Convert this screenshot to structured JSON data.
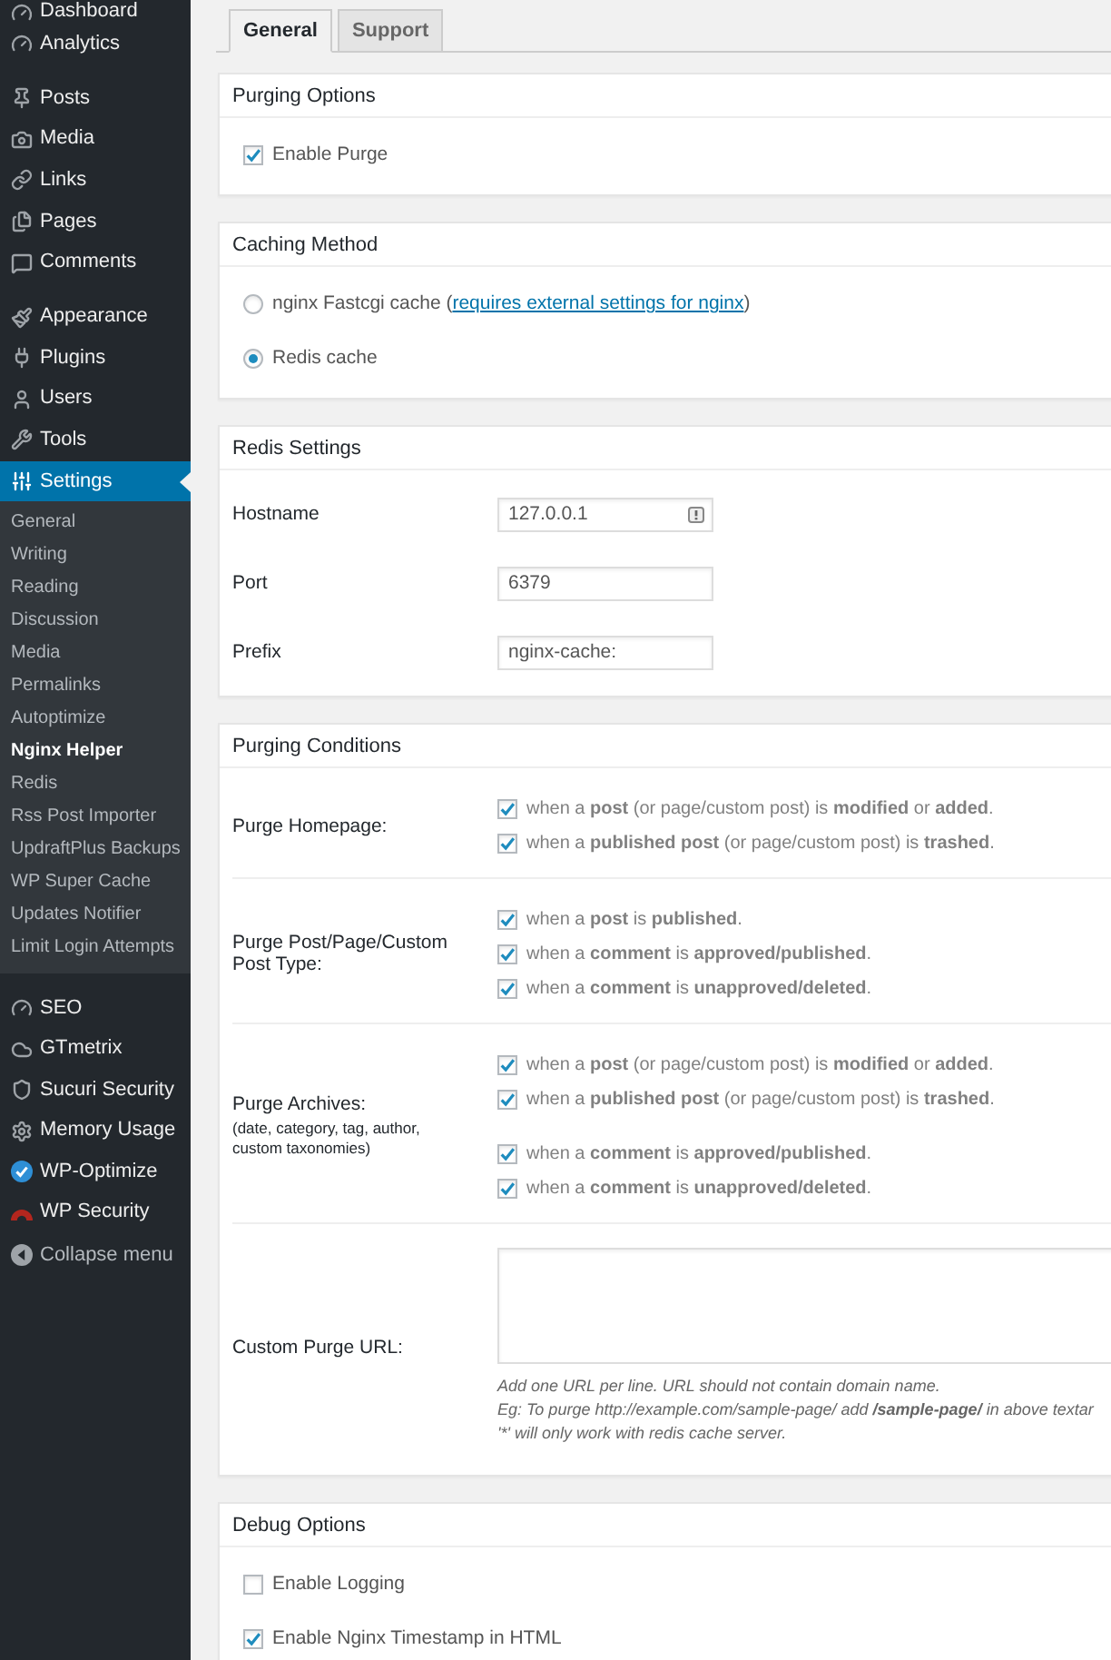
{
  "sidebar": {
    "groups": [
      {
        "items": [
          {
            "label": "Dashboard",
            "selected": false
          },
          {
            "label": "Analytics",
            "selected": false
          }
        ]
      },
      {
        "items": [
          {
            "label": "Posts",
            "selected": false
          },
          {
            "label": "Media",
            "selected": false
          },
          {
            "label": "Links",
            "selected": false
          },
          {
            "label": "Pages",
            "selected": false
          },
          {
            "label": "Comments",
            "selected": false
          }
        ]
      },
      {
        "items": [
          {
            "label": "Appearance",
            "selected": false
          },
          {
            "label": "Plugins",
            "selected": false
          },
          {
            "label": "Users",
            "selected": false
          },
          {
            "label": "Tools",
            "selected": false
          },
          {
            "label": "Settings",
            "selected": true,
            "children": [
              {
                "label": "General",
                "selected": false
              },
              {
                "label": "Writing",
                "selected": false
              },
              {
                "label": "Reading",
                "selected": false
              },
              {
                "label": "Discussion",
                "selected": false
              },
              {
                "label": "Media",
                "selected": false
              },
              {
                "label": "Permalinks",
                "selected": false
              },
              {
                "label": "Autoptimize",
                "selected": false
              },
              {
                "label": "Nginx Helper",
                "selected": true
              },
              {
                "label": "Redis",
                "selected": false
              },
              {
                "label": "Rss Post Importer",
                "selected": false
              },
              {
                "label": "UpdraftPlus Backups",
                "selected": false
              },
              {
                "label": "WP Super Cache",
                "selected": false
              },
              {
                "label": "Updates Notifier",
                "selected": false
              },
              {
                "label": "Limit Login Attempts",
                "selected": false
              }
            ]
          }
        ]
      },
      {
        "items": [
          {
            "label": "SEO",
            "selected": false
          },
          {
            "label": "GTmetrix",
            "selected": false
          },
          {
            "label": "Sucuri Security",
            "selected": false
          },
          {
            "label": "Memory Usage",
            "selected": false
          },
          {
            "label": "WP-Optimize",
            "selected": false
          },
          {
            "label": "WP Security",
            "selected": false
          }
        ]
      }
    ],
    "collapse": "Collapse menu"
  },
  "tabs": [
    {
      "label": "General",
      "selected": true
    },
    {
      "label": "Support",
      "selected": false
    }
  ],
  "sections": [
    {
      "title": "Purging Options",
      "kind": "checkboxes",
      "options": [
        {
          "label": "Enable Purge",
          "checked": true
        }
      ]
    },
    {
      "title": "Caching Method",
      "kind": "radios",
      "options": [
        {
          "label": "nginx Fastcgi cache (",
          "link": "requires external settings for nginx",
          "suffix": ")",
          "selected": false
        },
        {
          "label": "Redis cache",
          "selected": true
        }
      ]
    },
    {
      "title": "Redis Settings",
      "kind": "fields",
      "fields": [
        {
          "label": "Hostname",
          "value": "127.0.0.1",
          "autofill_badge": true
        },
        {
          "label": "Port",
          "value": "6379",
          "autofill_badge": false
        },
        {
          "label": "Prefix",
          "value": "nginx-cache:",
          "autofill_badge": false
        }
      ]
    },
    {
      "title": "Purging Conditions",
      "kind": "conditions",
      "rows": [
        {
          "kind": "checks",
          "label": "Purge Homepage:",
          "groups": [
            {
              "options": [
                {
                  "text": "when a **post** (or page/custom post) is **modified** or **added**.",
                  "checked": true
                },
                {
                  "text": "when a **published post** (or page/custom post) is **trashed**.",
                  "checked": true
                }
              ]
            }
          ]
        },
        {
          "kind": "checks",
          "label": "Purge Post/Page/Custom Post Type:",
          "groups": [
            {
              "options": [
                {
                  "text": "when a **post** is **published**.",
                  "checked": true
                },
                {
                  "text": "when a **comment** is **approved/published**.",
                  "checked": true
                },
                {
                  "text": "when a **comment** is **unapproved/deleted**.",
                  "checked": true
                }
              ]
            }
          ]
        },
        {
          "kind": "checks",
          "label": "Purge Archives:",
          "note": "(date, category, tag, author, custom taxonomies)",
          "groups": [
            {
              "options": [
                {
                  "text": "when a **post** (or page/custom post) is **modified** or **added**.",
                  "checked": true
                },
                {
                  "text": "when a **published post** (or page/custom post) is **trashed**.",
                  "checked": true
                }
              ]
            },
            {
              "options": [
                {
                  "text": "when a **comment** is **approved/published**.",
                  "checked": true
                },
                {
                  "text": "when a **comment** is **unapproved/deleted**.",
                  "checked": true
                }
              ]
            }
          ]
        },
        {
          "kind": "textarea",
          "label": "Custom Purge URL:",
          "description": [
            "Add one URL per line. URL should not contain domain name.",
            "Eg: To purge http://example.com/sample-page/ add **/sample-page/** in above textar",
            "'*' will only work with redis cache server."
          ]
        }
      ]
    },
    {
      "title": "Debug Options",
      "kind": "checkboxes",
      "options": [
        {
          "label": "Enable Logging",
          "checked": false
        },
        {
          "label": "Enable Nginx Timestamp in HTML",
          "checked": true
        }
      ]
    }
  ]
}
